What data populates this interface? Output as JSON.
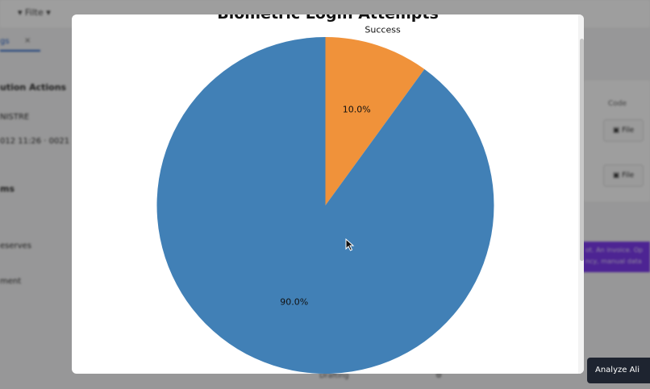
{
  "background": {
    "filter_label": "Filte",
    "tab_label": "gs",
    "tab_close": "×",
    "left_texts": [
      "ution Actions",
      "NISTRE",
      "012 11:26 · 0021",
      "ms",
      "eserves",
      "ment"
    ],
    "right_label": "Code",
    "file_buttons": [
      "File",
      "File"
    ],
    "purple_band_text": "ot. An invoice. Op ncy, manual data",
    "dark_button_label": "Analyze Ali",
    "bottom_texts": [
      "Drafting",
      "⚙"
    ]
  },
  "modal": {
    "title": "Biometric Login Attempts"
  },
  "chart_data": {
    "type": "pie",
    "title": "Biometric Login Attempts",
    "slices": [
      {
        "label": "Success",
        "value": 10.0,
        "pct_label": "10.0%",
        "color": "#f0923a"
      },
      {
        "label": "",
        "value": 90.0,
        "pct_label": "90.0%",
        "color": "#4180b6"
      }
    ],
    "start_angle_deg": 90,
    "direction": "counterclockwise-from-top-with-first-slice-clockwise"
  }
}
